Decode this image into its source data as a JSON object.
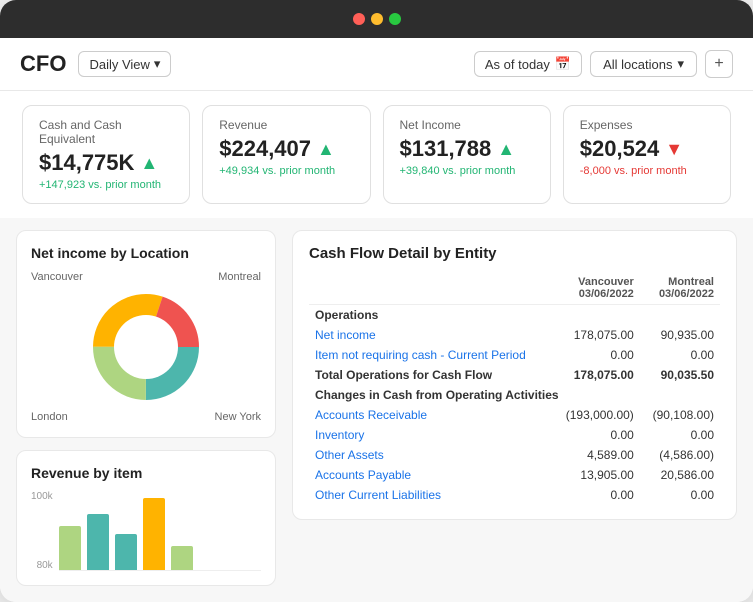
{
  "app": {
    "title": "CFO",
    "daily_view_label": "Daily View",
    "as_of_today_label": "As of today",
    "all_locations_label": "All locations",
    "plus_label": "+"
  },
  "kpis": [
    {
      "label": "Cash and Cash Equivalent",
      "value": "$14,775K",
      "trend": "up",
      "change": "+147,923 vs. prior month"
    },
    {
      "label": "Revenue",
      "value": "$224,407",
      "trend": "up",
      "change": "+49,934 vs. prior month"
    },
    {
      "label": "Net Income",
      "value": "$131,788",
      "trend": "up",
      "change": "+39,840 vs. prior month"
    },
    {
      "label": "Expenses",
      "value": "$20,524",
      "trend": "down",
      "change": "-8,000 vs. prior month"
    }
  ],
  "donut_chart": {
    "title": "Net income by Location",
    "labels": {
      "top_left": "Vancouver",
      "top_right": "Montreal",
      "bottom_left": "London",
      "bottom_right": "New York"
    },
    "segments": [
      {
        "color": "#4db6ac",
        "percent": 25
      },
      {
        "color": "#aed581",
        "percent": 25
      },
      {
        "color": "#ffb300",
        "percent": 30
      },
      {
        "color": "#ef5350",
        "percent": 20
      }
    ]
  },
  "bar_chart": {
    "title": "Revenue by item",
    "y_labels": [
      "100k",
      "80k"
    ],
    "bars": [
      {
        "color": "#aed581",
        "height": 0.55
      },
      {
        "color": "#4db6ac",
        "height": 0.7
      },
      {
        "color": "#4db6ac",
        "height": 0.45
      },
      {
        "color": "#ffb300",
        "height": 0.9
      },
      {
        "color": "#aed581",
        "height": 0.3
      }
    ]
  },
  "cash_flow": {
    "title": "Cash Flow Detail by Entity",
    "columns": [
      {
        "label": "",
        "sub": ""
      },
      {
        "label": "Vancouver",
        "sub": "03/06/2022"
      },
      {
        "label": "Montreal",
        "sub": "03/06/2022"
      }
    ],
    "sections": [
      {
        "header": "Operations",
        "rows": [
          {
            "label": "Net income",
            "link": true,
            "vancouver": "178,075.00",
            "montreal": "90,935.00"
          },
          {
            "label": "Item not requiring cash - Current Period",
            "link": true,
            "vancouver": "0.00",
            "montreal": "0.00"
          },
          {
            "label": "Total Operations for Cash Flow",
            "link": false,
            "bold": true,
            "vancouver": "178,075.00",
            "montreal": "90,035.50"
          }
        ]
      },
      {
        "header": "Changes in Cash from Operating Activities",
        "rows": [
          {
            "label": "Accounts Receivable",
            "link": true,
            "vancouver": "(193,000.00)",
            "montreal": "(90,108.00)"
          },
          {
            "label": "Inventory",
            "link": true,
            "vancouver": "0.00",
            "montreal": "0.00"
          },
          {
            "label": "Other Assets",
            "link": true,
            "vancouver": "4,589.00",
            "montreal": "(4,586.00)"
          },
          {
            "label": "Accounts Payable",
            "link": true,
            "vancouver": "13,905.00",
            "montreal": "20,586.00"
          },
          {
            "label": "Other Current Liabilities",
            "link": true,
            "vancouver": "0.00",
            "montreal": "0.00"
          }
        ]
      }
    ]
  }
}
